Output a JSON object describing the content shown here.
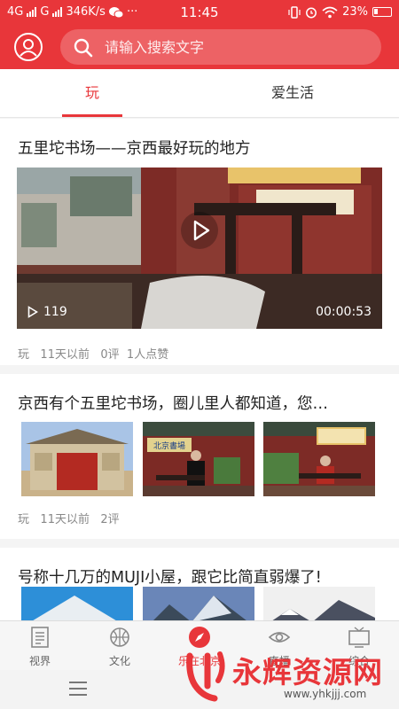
{
  "status_bar": {
    "carrier_left": "4G",
    "carrier_mid": "G",
    "speed": "346K/s",
    "dots": "···",
    "time": "11:45",
    "battery": "23%"
  },
  "search": {
    "placeholder": "请输入搜索文字"
  },
  "tabs": [
    {
      "label": "玩",
      "active": true
    },
    {
      "label": "爱生活",
      "active": false
    }
  ],
  "feed": [
    {
      "title": "五里坨书场——京西最好玩的地方",
      "views": "119",
      "duration": "00:00:53",
      "meta": {
        "category": "玩",
        "time": "11天以前",
        "comments": "0评",
        "likes": "1人点赞"
      }
    },
    {
      "title": "京西有个五里坨书场，圈儿里人都知道，您…",
      "meta": {
        "category": "玩",
        "time": "11天以前",
        "comments": "2评"
      },
      "sign_text": "北京書場"
    },
    {
      "title": "号称十几万的MUJI小屋，跟它比简直弱爆了!"
    }
  ],
  "bottom_nav": [
    {
      "label": "视界",
      "icon": "newspaper-icon",
      "active": false
    },
    {
      "label": "文化",
      "icon": "basketball-icon",
      "active": false
    },
    {
      "label": "乐在北京",
      "icon": "compass-icon",
      "active": true
    },
    {
      "label": "直播",
      "icon": "eye-icon",
      "active": false
    },
    {
      "label": "综合",
      "icon": "tv-icon",
      "active": false
    }
  ],
  "watermark": {
    "title": "永辉资源网",
    "url": "www.yhkjjj.com"
  },
  "colors": {
    "brand_red": "#e8363a"
  }
}
